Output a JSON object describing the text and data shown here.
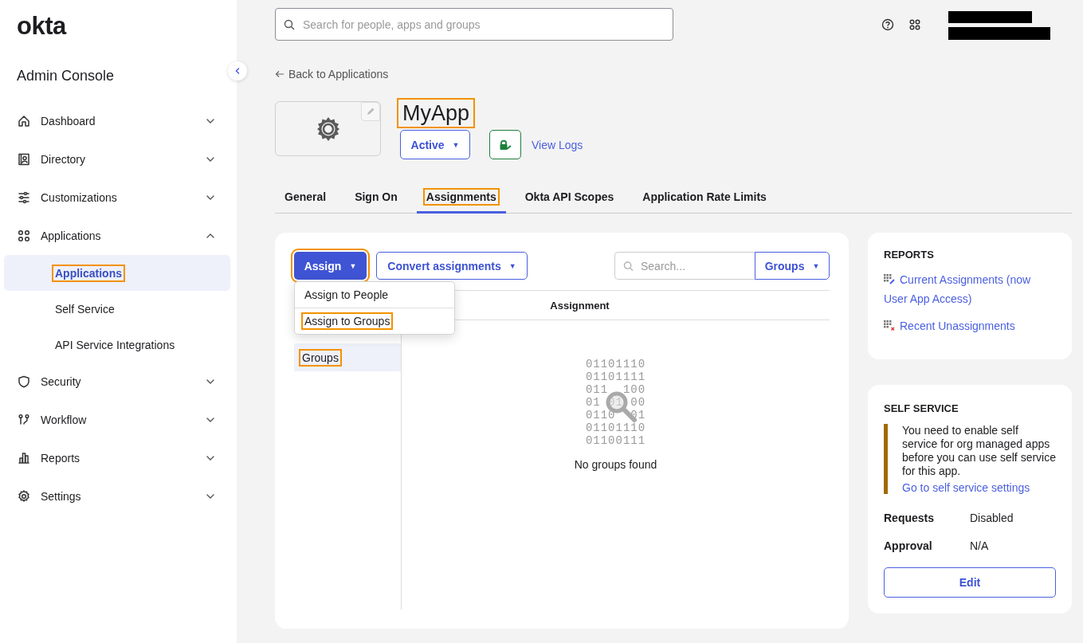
{
  "logo": {
    "text": "okta"
  },
  "sidebar": {
    "title": "Admin Console",
    "items": [
      {
        "label": "Dashboard",
        "expanded": false
      },
      {
        "label": "Directory",
        "expanded": false
      },
      {
        "label": "Customizations",
        "expanded": false
      },
      {
        "label": "Applications",
        "expanded": true,
        "children": [
          {
            "label": "Applications",
            "selected": true,
            "highlighted": true
          },
          {
            "label": "Self Service",
            "selected": false,
            "highlighted": false
          },
          {
            "label": "API Service Integrations",
            "selected": false,
            "highlighted": false
          }
        ]
      },
      {
        "label": "Security",
        "expanded": false
      },
      {
        "label": "Workflow",
        "expanded": false
      },
      {
        "label": "Reports",
        "expanded": false
      },
      {
        "label": "Settings",
        "expanded": false
      }
    ]
  },
  "topbar": {
    "search": {
      "placeholder": "Search for people, apps and groups"
    }
  },
  "back_link": "Back to Applications",
  "app": {
    "name": "MyApp",
    "name_highlighted": true,
    "status": "Active",
    "status_caret": "▼",
    "view_logs": "View Logs"
  },
  "tabs": [
    {
      "label": "General",
      "selected": false,
      "highlighted": false
    },
    {
      "label": "Sign On",
      "selected": false,
      "highlighted": false
    },
    {
      "label": "Assignments",
      "selected": true,
      "highlighted": true
    },
    {
      "label": "Okta API Scopes",
      "selected": false,
      "highlighted": false
    },
    {
      "label": "Application Rate Limits",
      "selected": false,
      "highlighted": false
    }
  ],
  "assignments": {
    "assign_button": {
      "label": "Assign",
      "caret": "▼",
      "highlighted": true,
      "expanded": true
    },
    "menu": [
      {
        "label": "Assign to People",
        "highlighted": false
      },
      {
        "label": "Assign to Groups",
        "highlighted": true
      }
    ],
    "convert_button": {
      "label": "Convert assignments",
      "caret": "▼"
    },
    "search": {
      "placeholder": "Search..."
    },
    "filter": {
      "label": "Groups",
      "caret": "▼"
    },
    "column": "Assignment",
    "filters": [
      {
        "label": "Groups",
        "selected": true,
        "highlighted": true
      }
    ],
    "empty": {
      "binary": [
        "01101110",
        "01101111",
        "011  100",
        "01 01 00",
        "0110  01",
        "01101110",
        "01100111"
      ],
      "message": "No groups found"
    }
  },
  "reports": {
    "title": "REPORTS",
    "links": [
      {
        "label": "Current Assignments (now User App Access)",
        "kind": "edit"
      },
      {
        "label": "Recent Unassignments",
        "kind": "remove"
      }
    ]
  },
  "self_service": {
    "title": "SELF SERVICE",
    "notice": "You need to enable self service for org managed apps before you can use self service for this app.",
    "notice_link": "Go to self service settings",
    "fields": [
      {
        "label": "Requests",
        "value": "Disabled"
      },
      {
        "label": "Approval",
        "value": "N/A"
      }
    ],
    "edit": "Edit"
  }
}
